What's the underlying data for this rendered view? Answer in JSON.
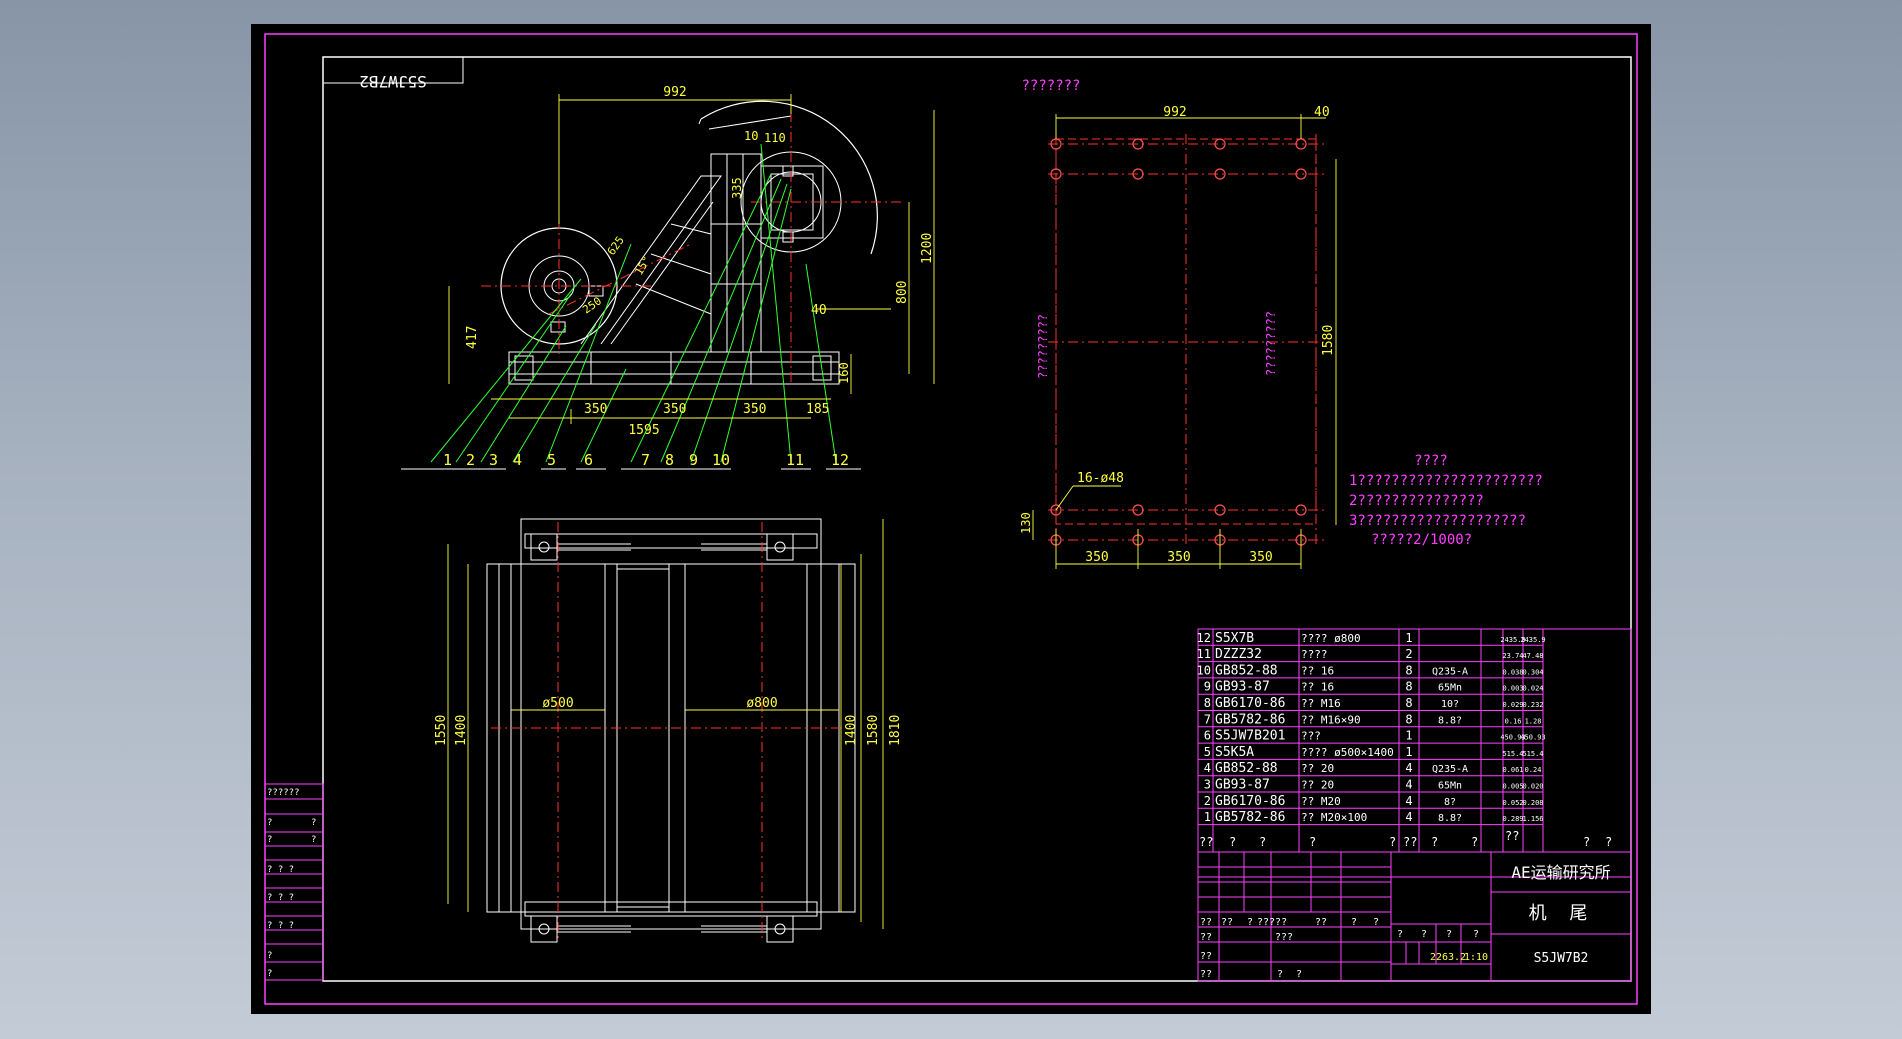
{
  "drawing": {
    "mirrored_code": "S5JW7B2",
    "drawing_number": "S5JW7B2",
    "institute": "AE运输研究所",
    "part_name": "机  尾",
    "scale_weight": "2263.2",
    "scale": "1:10"
  },
  "dims_elevation": {
    "d992": "992",
    "d10": "10",
    "d110": "110",
    "d335": "335",
    "d1200": "1200",
    "d800": "800",
    "d40": "40",
    "d417": "417",
    "d625": "625",
    "d250": "250",
    "d160": "160",
    "d350a": "350",
    "d350b": "350",
    "d350c": "350",
    "d185": "185",
    "d1595": "1595",
    "d15": "15°"
  },
  "balloons": [
    "1",
    "2",
    "3",
    "4",
    "5",
    "6",
    "7",
    "8",
    "9",
    "10",
    "11",
    "12"
  ],
  "dims_plan": {
    "dia500": "ø500",
    "dia800": "ø800",
    "d1550": "1550",
    "d1400a": "1400",
    "d1400b": "1400",
    "d1580": "1580",
    "d1810": "1810"
  },
  "foundation": {
    "title": "???????",
    "d992": "992",
    "d40": "40",
    "d1580": "1580",
    "holes": "16-ø48",
    "d130": "130",
    "d350a": "350",
    "d350b": "350",
    "d350c": "350",
    "left_label": "?????????",
    "right_label": "?????????"
  },
  "notes": {
    "title": "????",
    "line1": "1??????????????????????",
    "line2": "2???????????????",
    "line3": "3????????????????????",
    "line4": "?????2/1000?"
  },
  "bom": [
    {
      "no": "12",
      "code": "S5X7B",
      "name": "???? ø800",
      "qty": "1",
      "material": "",
      "unit": "2435.9",
      "total": "2435.9"
    },
    {
      "no": "11",
      "code": "DZZZ32",
      "name": "????",
      "qty": "2",
      "material": "",
      "unit": "23.74",
      "total": "47.48"
    },
    {
      "no": "10",
      "code": "GB852-88",
      "name": "?? 16",
      "qty": "8",
      "material": "Q235-A",
      "unit": "0.038",
      "total": "0.304"
    },
    {
      "no": "9",
      "code": "GB93-87",
      "name": "?? 16",
      "qty": "8",
      "material": "65Mn",
      "unit": "0.003",
      "total": "0.024"
    },
    {
      "no": "8",
      "code": "GB6170-86",
      "name": "?? M16",
      "qty": "8",
      "material": "10?",
      "unit": "0.029",
      "total": "0.232"
    },
    {
      "no": "7",
      "code": "GB5782-86",
      "name": "?? M16×90",
      "qty": "8",
      "material": "8.8?",
      "unit": "0.16",
      "total": "1.28"
    },
    {
      "no": "6",
      "code": "S5JW7B201",
      "name": "???",
      "qty": "1",
      "material": "",
      "unit": "450.93",
      "total": "450.93"
    },
    {
      "no": "5",
      "code": "S5K5A",
      "name": "???? ø500×1400",
      "qty": "1",
      "material": "",
      "unit": "515.4",
      "total": "515.4"
    },
    {
      "no": "4",
      "code": "GB852-88",
      "name": "?? 20",
      "qty": "4",
      "material": "Q235-A",
      "unit": "0.061",
      "total": "0.24"
    },
    {
      "no": "3",
      "code": "GB93-87",
      "name": "?? 20",
      "qty": "4",
      "material": "65Mn",
      "unit": "0.005",
      "total": "0.020"
    },
    {
      "no": "2",
      "code": "GB6170-86",
      "name": "?? M20",
      "qty": "4",
      "material": "8?",
      "unit": "0.052",
      "total": "0.208"
    },
    {
      "no": "1",
      "code": "GB5782-86",
      "name": "?? M20×100",
      "qty": "4",
      "material": "8.8?",
      "unit": "0.289",
      "total": "1.156"
    }
  ],
  "bom_header": [
    "??",
    "?",
    "?",
    "?",
    "?",
    "??",
    "?",
    "?",
    "??",
    "?",
    "?"
  ],
  "title_block": {
    "r1": [
      "??",
      "??",
      "?",
      "?????",
      "??",
      "?",
      "?"
    ],
    "r2": [
      "??",
      "???"
    ],
    "r3": [
      "??"
    ],
    "r4": [
      "??",
      "?",
      "?"
    ],
    "r5": [
      "?",
      "?",
      "?",
      "?"
    ],
    "side": [
      "??????",
      "?",
      "?",
      "?",
      "?",
      "? ? ?",
      "?",
      "? ? ?",
      "?",
      "? ? ?",
      "?",
      "?"
    ]
  }
}
